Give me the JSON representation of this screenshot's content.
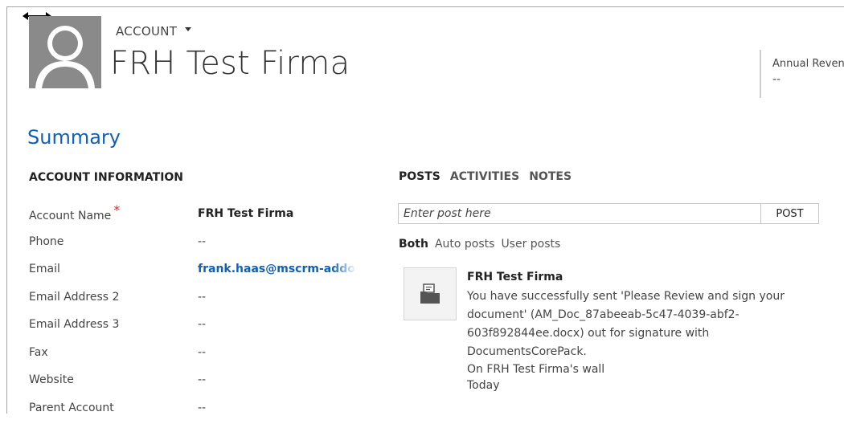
{
  "header": {
    "entity_type": "ACCOUNT",
    "record_name": "FRH Test Firma",
    "field": {
      "label": "Annual Revenue",
      "value": "--"
    }
  },
  "summary": {
    "title": "Summary",
    "section_title": "ACCOUNT INFORMATION",
    "rows": [
      {
        "label": "Account Name",
        "value": "FRH Test Firma",
        "required": true
      },
      {
        "label": "Phone",
        "value": "--"
      },
      {
        "label": "Email",
        "value": "frank.haas@mscrm-addons.com"
      },
      {
        "label": "Email Address 2",
        "value": "--"
      },
      {
        "label": "Email Address 3",
        "value": "--"
      },
      {
        "label": "Fax",
        "value": "--"
      },
      {
        "label": "Website",
        "value": "--"
      },
      {
        "label": "Parent Account",
        "value": "--"
      }
    ],
    "required_marker": "*"
  },
  "activity": {
    "tabs": [
      "POSTS",
      "ACTIVITIES",
      "NOTES"
    ],
    "post_placeholder": "Enter post here",
    "post_button": "POST",
    "filters": [
      "Both",
      "Auto posts",
      "User posts"
    ],
    "post": {
      "author": "FRH Test Firma",
      "text": "You have successfully sent 'Please Review and sign your document' (AM_Doc_87abeeab-5c47-4039-abf2-603f892844ee.docx) out for signature with DocumentsCorePack.",
      "wall": "On FRH Test Firma's wall",
      "time": "Today"
    }
  },
  "colors": {
    "accent_blue": "#1160b7",
    "required_red": "#e0282a",
    "avatar_gray": "#8a8a8a"
  },
  "icons": [
    "resize-arrow-icon",
    "caret-down-icon",
    "avatar-placeholder-icon",
    "document-post-icon"
  ]
}
